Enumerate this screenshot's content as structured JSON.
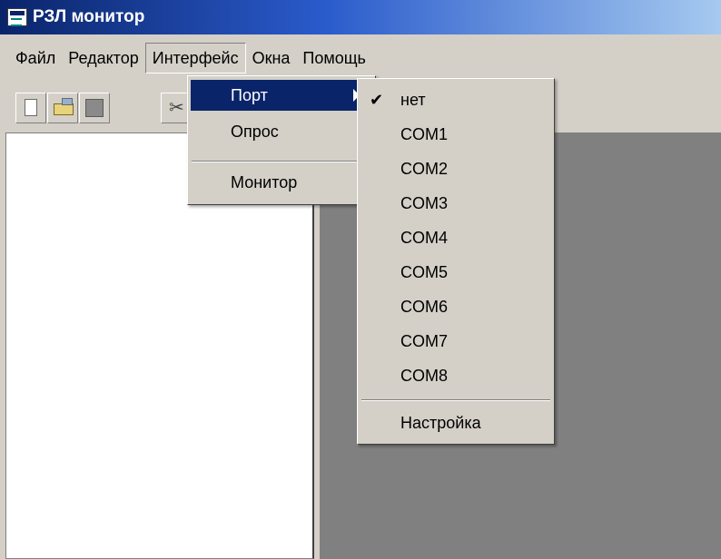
{
  "window": {
    "title": "РЗЛ монитор"
  },
  "menubar": {
    "items": [
      {
        "label": "Файл"
      },
      {
        "label": "Редактор"
      },
      {
        "label": "Интерфейс"
      },
      {
        "label": "Окна"
      },
      {
        "label": "Помощь"
      }
    ]
  },
  "toolbar": {
    "buttons": [
      "new-file-icon",
      "open-folder-icon",
      "save-icon",
      "cut-icon"
    ]
  },
  "interface_menu": {
    "items": [
      {
        "label": "Порт"
      },
      {
        "label": "Опрос"
      },
      {
        "label": "Монитор"
      }
    ]
  },
  "port_menu": {
    "check_mark": "✔",
    "items": [
      {
        "label": "нет"
      },
      {
        "label": "COM1"
      },
      {
        "label": "COM2"
      },
      {
        "label": "COM3"
      },
      {
        "label": "COM4"
      },
      {
        "label": "COM5"
      },
      {
        "label": "COM6"
      },
      {
        "label": "COM7"
      },
      {
        "label": "COM8"
      },
      {
        "label": "Настройка"
      }
    ]
  },
  "colors": {
    "highlight": "#0a246a",
    "face": "#d4d0c8",
    "mdi_background": "#808080"
  }
}
